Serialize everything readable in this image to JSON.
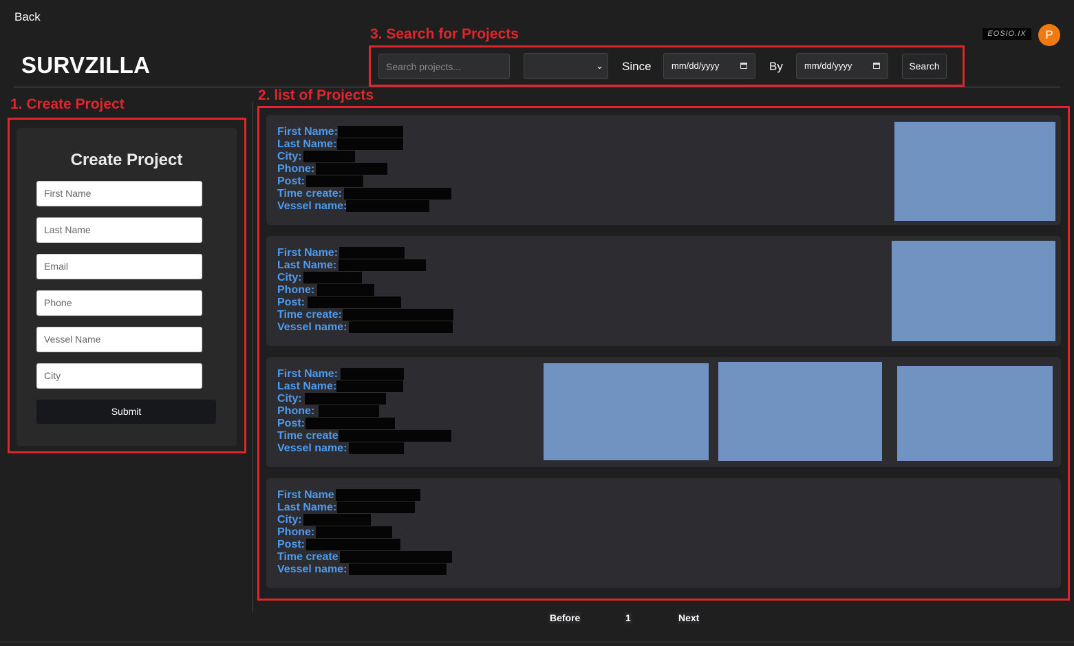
{
  "nav": {
    "back_label": "Back"
  },
  "brand": {
    "name": "SURVZILLA"
  },
  "user": {
    "avatar_initial": "P",
    "logo_text": "EOSIO.IX"
  },
  "annotations": {
    "create": "1. Create Project",
    "list": "2. list of Projects",
    "search": "3. Search for Projects"
  },
  "search": {
    "placeholder": "Search projects...",
    "select_value": "",
    "since_label": "Since",
    "by_label": "By",
    "date_placeholder": "mm/dd/yyyy",
    "button_label": "Search"
  },
  "create_form": {
    "title": "Create Project",
    "fields": [
      "First Name",
      "Last Name",
      "Email",
      "Phone",
      "Vessel Name",
      "City"
    ],
    "submit_label": "Submit"
  },
  "projects": [
    {
      "labels": [
        "First Name:",
        "Last Name:",
        "City:",
        "Phone:",
        "Post:",
        "Time create:",
        "Vessel name:"
      ],
      "images": 1
    },
    {
      "labels": [
        "First Name:",
        "Last Name:",
        "City:",
        "Phone:",
        "Post:",
        "Time create:",
        "Vessel name:"
      ],
      "images": 1
    },
    {
      "labels": [
        "First Name:",
        "Last Name:",
        "City:",
        "Phone:",
        "Post:",
        "Time create",
        "Vessel name:"
      ],
      "images": 3
    },
    {
      "labels": [
        "First Name",
        "Last Name:",
        "City:",
        "Phone:",
        "Post:",
        "Time create",
        "Vessel name:"
      ],
      "images": 0
    }
  ],
  "pagination": {
    "prev_label": "Before",
    "current_page": "1",
    "next_label": "Next"
  },
  "colors": {
    "annotation": "#e0262a",
    "label_blue": "#4d9cf2",
    "thumbnail": "#7193c2",
    "avatar": "#f07a10"
  }
}
